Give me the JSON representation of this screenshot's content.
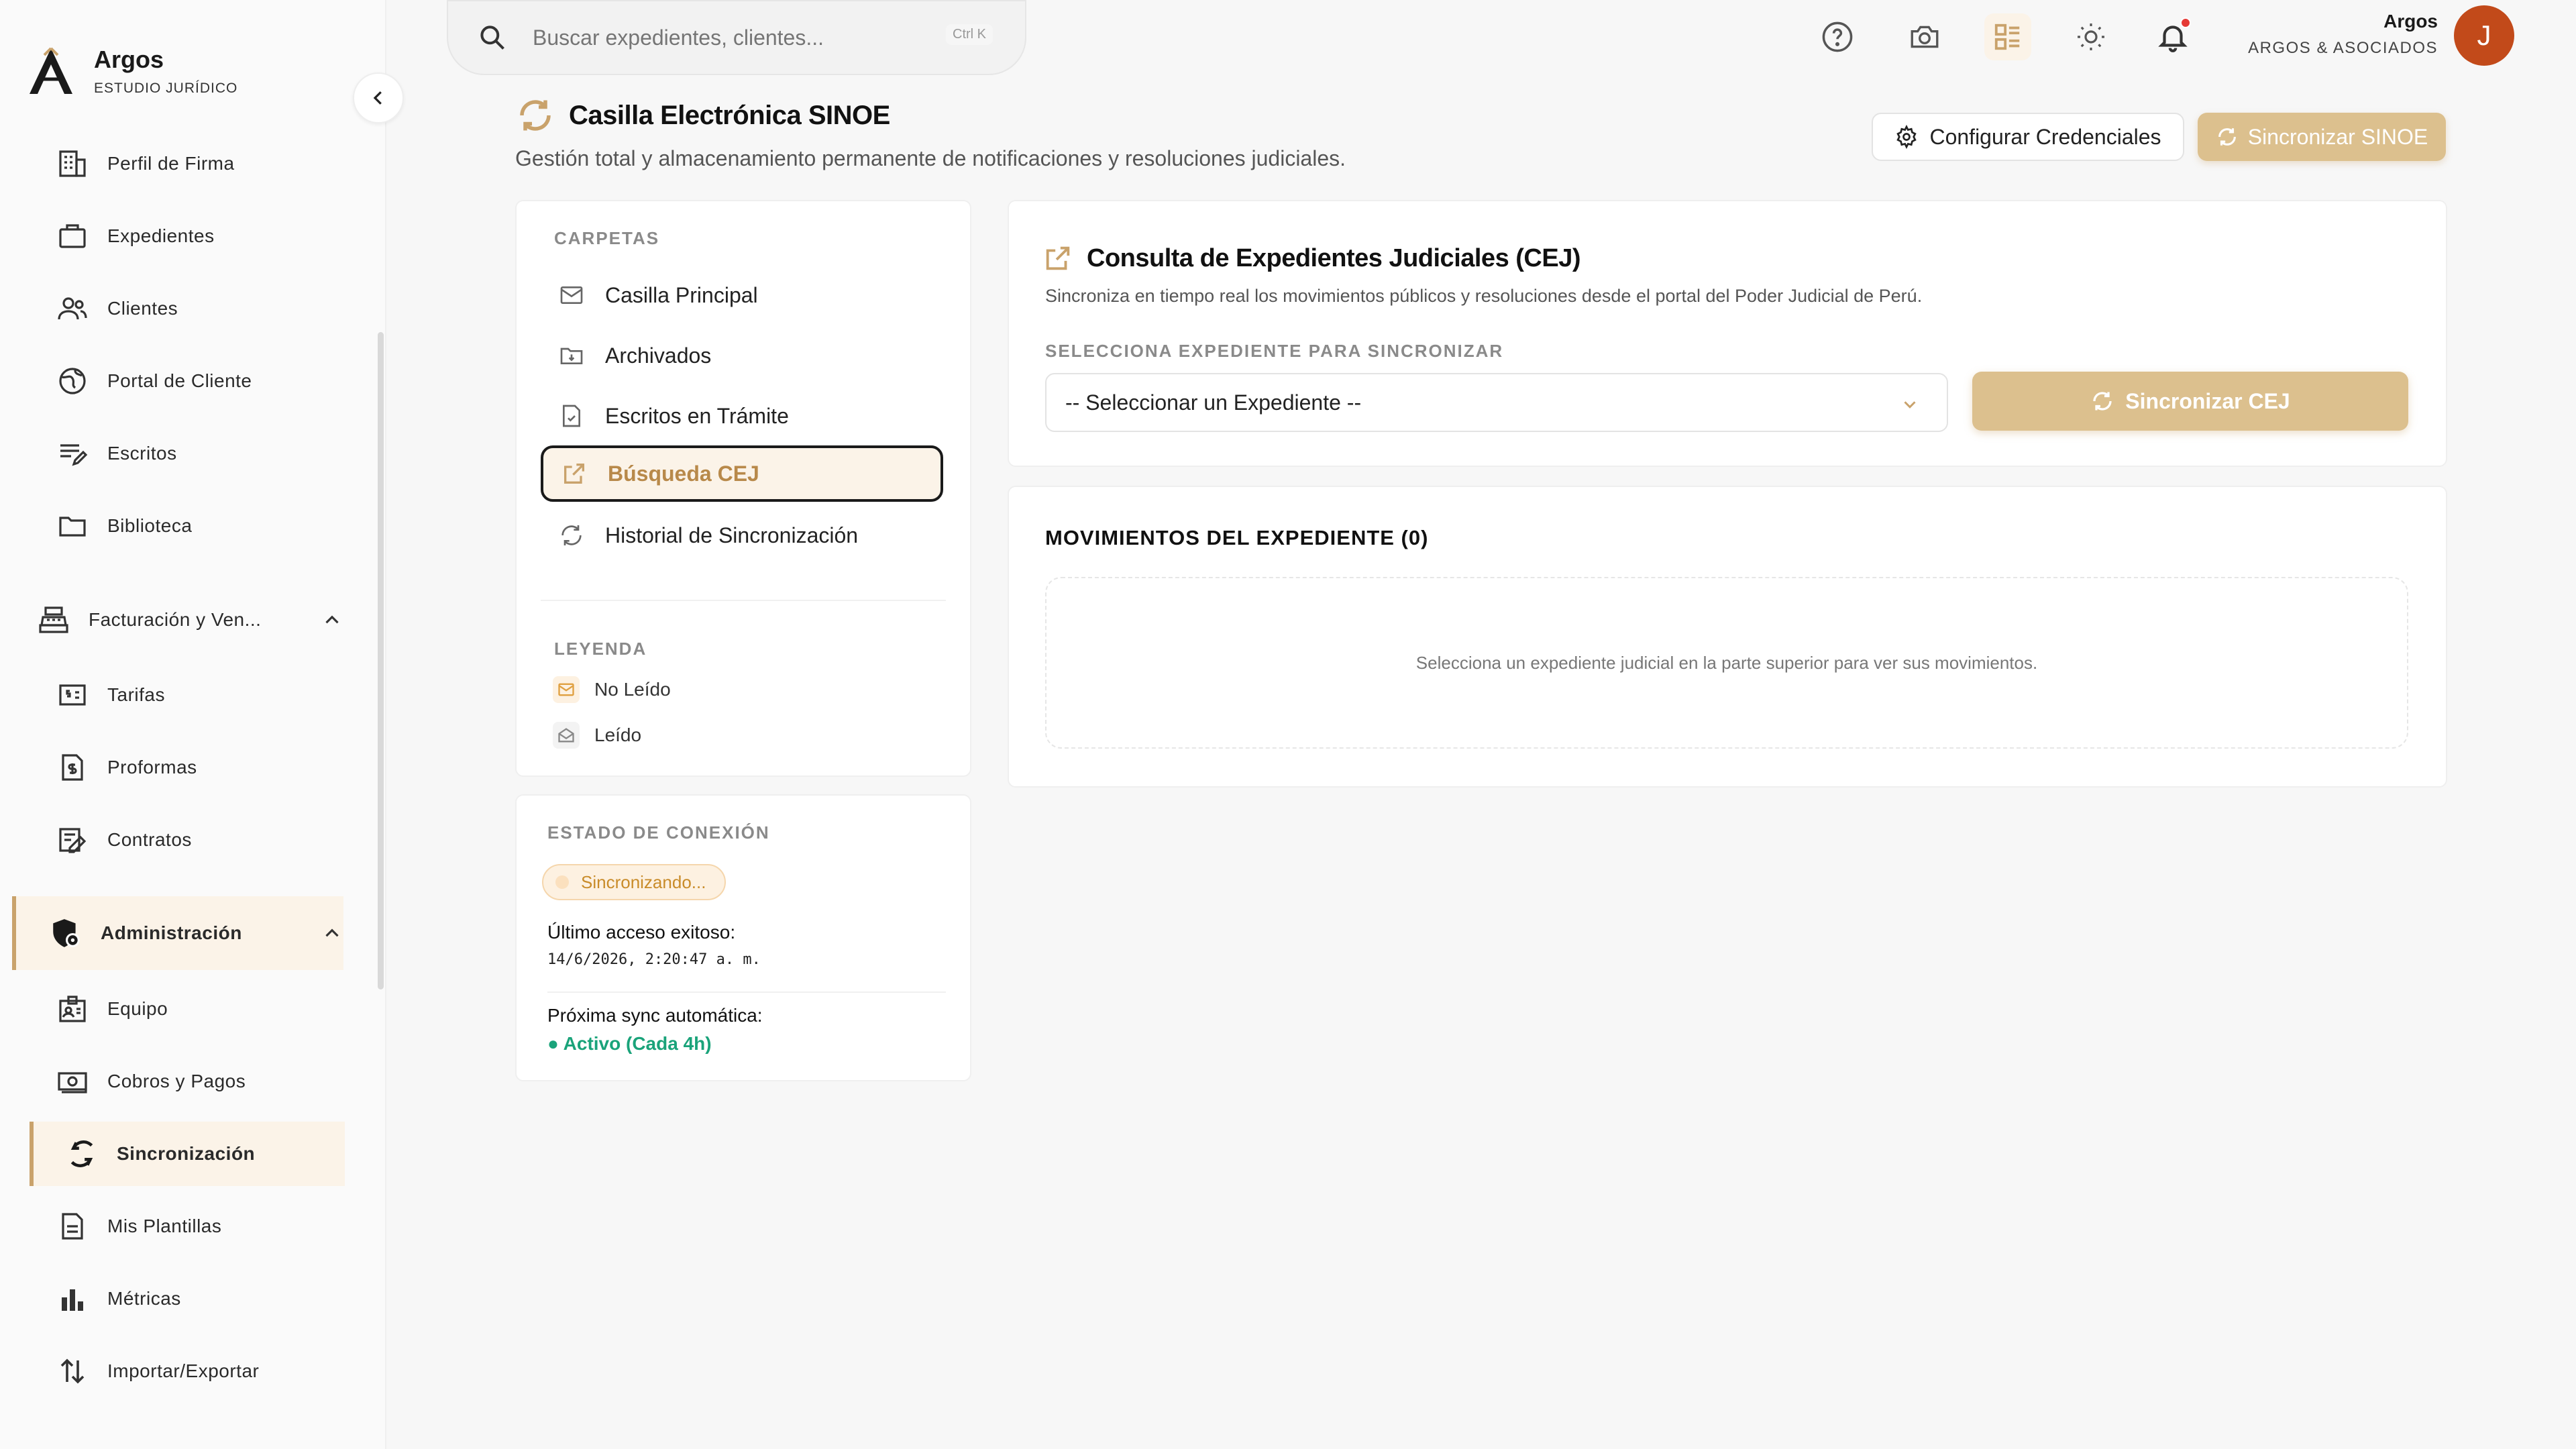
{
  "brand": {
    "name": "Argos",
    "subtitle": "ESTUDIO JURÍDICO"
  },
  "sidebar": {
    "items": [
      {
        "label": "Perfil de Firma",
        "icon": "building-icon"
      },
      {
        "label": "Expedientes",
        "icon": "briefcase-icon"
      },
      {
        "label": "Clientes",
        "icon": "users-icon"
      },
      {
        "label": "Portal de Cliente",
        "icon": "globe-icon"
      },
      {
        "label": "Escritos",
        "icon": "edit-lines-icon"
      },
      {
        "label": "Biblioteca",
        "icon": "folder-icon"
      }
    ],
    "group_billing": {
      "label": "Facturación y Ven...",
      "icon": "cash-register-icon"
    },
    "billing_items": [
      {
        "label": "Tarifas",
        "icon": "price-tag-icon"
      },
      {
        "label": "Proformas",
        "icon": "invoice-icon"
      },
      {
        "label": "Contratos",
        "icon": "contract-icon"
      }
    ],
    "group_admin": {
      "label": "Administración",
      "icon": "shield-gear-icon"
    },
    "admin_items": [
      {
        "label": "Equipo",
        "icon": "id-badge-icon"
      },
      {
        "label": "Cobros y Pagos",
        "icon": "money-icon"
      },
      {
        "label": "Sincronización",
        "icon": "sync-icon"
      },
      {
        "label": "Mis Plantillas",
        "icon": "document-icon"
      },
      {
        "label": "Métricas",
        "icon": "bar-chart-icon"
      },
      {
        "label": "Importar/Exportar",
        "icon": "import-export-icon"
      }
    ]
  },
  "topbar": {
    "search_placeholder": "Buscar expedientes, clientes...",
    "shortcut": "Ctrl K",
    "user_name": "Argos",
    "user_org": "ARGOS & ASOCIADOS",
    "avatar_initial": "J"
  },
  "header": {
    "title": "Casilla Electrónica SINOE",
    "subtitle": "Gestión total y almacenamiento permanente de notificaciones y resoluciones judiciales.",
    "config_button": "Configurar Credenciales",
    "sync_button": "Sincronizar SINOE"
  },
  "folders": {
    "label": "CARPETAS",
    "items": [
      "Casilla Principal",
      "Archivados",
      "Escritos en Trámite",
      "Búsqueda CEJ",
      "Historial de Sincronización"
    ],
    "active_index": 3
  },
  "legend": {
    "label": "LEYENDA",
    "unread": "No Leído",
    "read": "Leído"
  },
  "connection": {
    "label": "ESTADO DE CONEXIÓN",
    "status": "Sincronizando...",
    "last_access_label": "Último acceso exitoso:",
    "last_access_value": "14/6/2026, 2:20:47 a. m.",
    "next_sync_label": "Próxima sync automática:",
    "next_sync_value": "● Activo (Cada 4h)"
  },
  "cej": {
    "title": "Consulta de Expedientes Judiciales (CEJ)",
    "description": "Sincroniza en tiempo real los movimientos públicos y resoluciones desde el portal del Poder Judicial de Perú.",
    "select_label": "SELECCIONA EXPEDIENTE PARA SINCRONIZAR",
    "select_value": "-- Seleccionar un Expediente --",
    "sync_button": "Sincronizar CEJ"
  },
  "movements": {
    "title": "MOVIMIENTOS DEL EXPEDIENTE (0)",
    "empty_text": "Selecciona un expediente judicial en la parte superior para ver sus movimientos."
  },
  "colors": {
    "accent": "#c9a26b",
    "accent_light": "#fbf3e8",
    "button_gold": "#dcc08e",
    "avatar": "#c24a1a",
    "active_green": "#1aa37a",
    "notification": "#e53935"
  }
}
